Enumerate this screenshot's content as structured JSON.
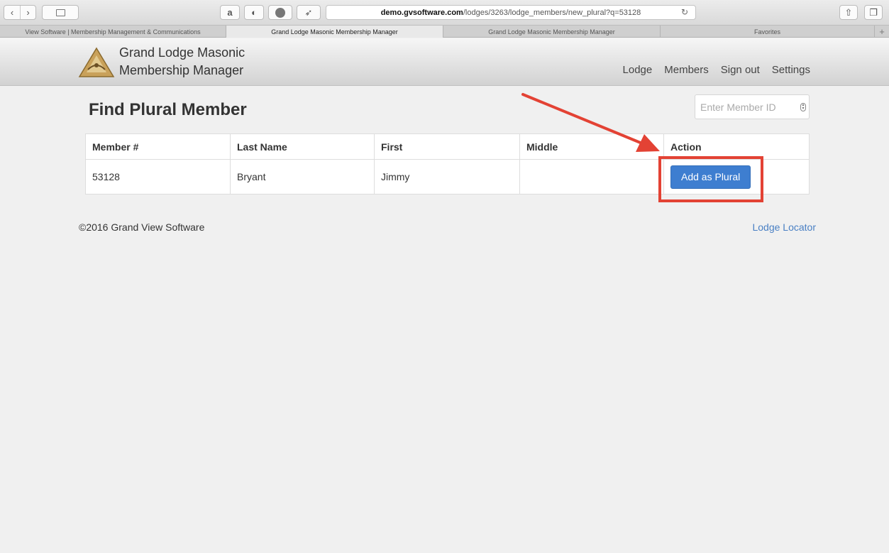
{
  "browser": {
    "address_host": "demo.gvsoftware.com",
    "address_path": "/lodges/3263/lodge_members/new_plural?q=53128",
    "tabs": [
      {
        "label": "View Software | Membership Management & Communications"
      },
      {
        "label": "Grand Lodge Masonic Membership Manager"
      },
      {
        "label": "Grand Lodge Masonic Membership Manager"
      },
      {
        "label": "Favorites"
      }
    ]
  },
  "header": {
    "brand_line1": "Grand Lodge Masonic",
    "brand_line2": "Membership Manager",
    "nav": [
      "Lodge",
      "Members",
      "Sign out",
      "Settings"
    ]
  },
  "main": {
    "title": "Find Plural Member",
    "member_id_placeholder": "Enter Member ID",
    "table": {
      "columns": [
        "Member #",
        "Last Name",
        "First",
        "Middle",
        "Action"
      ],
      "rows": [
        {
          "member_no": "53128",
          "last": "Bryant",
          "first": "Jimmy",
          "middle": "",
          "action_label": "Add as Plural"
        }
      ]
    }
  },
  "footer": {
    "copyright": "©2016 Grand View Software",
    "link": "Lodge Locator"
  },
  "colors": {
    "accent": "#3e7ed0",
    "annotation": "#e34234",
    "link": "#4a80c4"
  }
}
